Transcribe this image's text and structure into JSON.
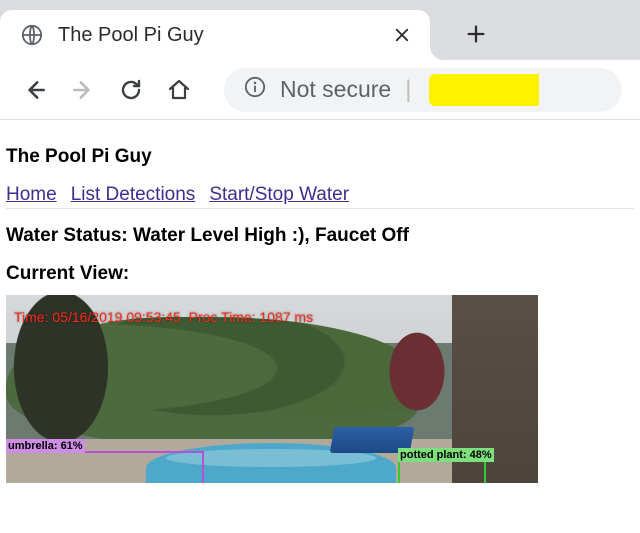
{
  "browser": {
    "tab_title": "The Pool Pi Guy",
    "address_label": "Not secure",
    "address_divider": "|"
  },
  "page": {
    "site_title": "The Pool Pi Guy",
    "nav": {
      "home": "Home",
      "list": "List Detections",
      "water": "Start/Stop Water"
    },
    "status_heading": "Water Status:",
    "status_value": "Water Level High :), Faucet Off",
    "current_view_heading": "Current View:"
  },
  "camera": {
    "overlay_time": "Time: 05/16/2019  09:53:45",
    "overlay_proc": "Proc Time: 1087 ms",
    "detections": {
      "umbrella": "umbrella: 61%",
      "plant": "potted plant: 48%"
    }
  }
}
